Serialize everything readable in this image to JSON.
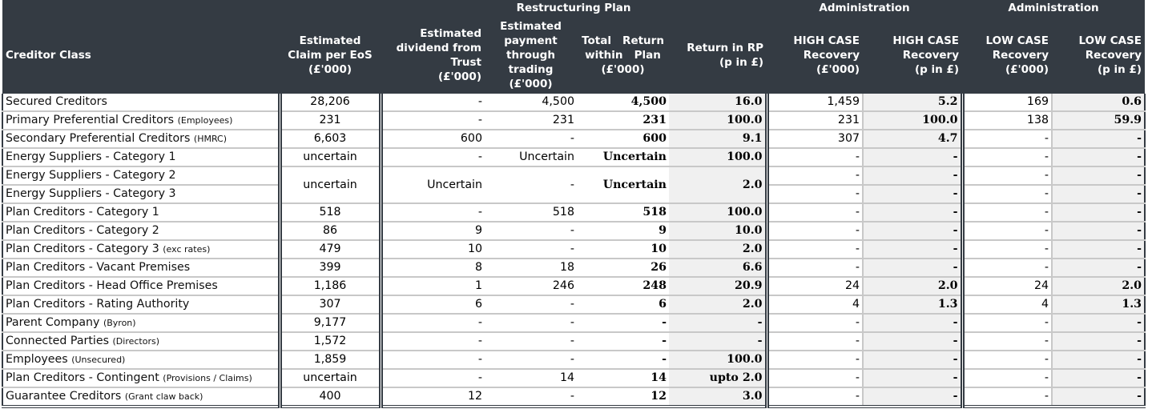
{
  "header": {
    "group_restructuring": "Restructuring Plan",
    "group_admin_high": "Administration",
    "group_admin_low": "Administration",
    "columns": [
      {
        "key": "creditor_class",
        "label": "Creditor Class"
      },
      {
        "key": "claim",
        "label": "Estimated Claim per EoS (£'000)"
      },
      {
        "key": "dividend_trust",
        "label": "Estimated dividend from Trust (£'000)"
      },
      {
        "key": "payment_trading",
        "label": "Estimated payment through trading (£'000)"
      },
      {
        "key": "total_return",
        "label": "Total Return within Plan (£'000)"
      },
      {
        "key": "return_rp",
        "label": "Return in RP (p in £)"
      },
      {
        "key": "high_recovery_k",
        "label": "HIGH CASE Recovery (£'000)"
      },
      {
        "key": "high_recovery_p",
        "label": "HIGH CASE Recovery (p in £)"
      },
      {
        "key": "low_recovery_k",
        "label": "LOW CASE Recovery (£'000)"
      },
      {
        "key": "low_recovery_p",
        "label": "LOW CASE Recovery (p in £)"
      }
    ],
    "col_lines": {
      "claim": [
        "Estimated",
        "Claim per EoS",
        "(£'000)"
      ],
      "dividend_trust": [
        "Estimated",
        "dividend from",
        "Trust",
        "(£'000)"
      ],
      "payment_trading": [
        "Estimated",
        "payment",
        "through",
        "trading",
        "(£'000)"
      ],
      "total_return": [
        "Total   Return",
        "within   Plan",
        "(£'000)"
      ],
      "return_rp": [
        "Return in RP",
        "(p in £)"
      ],
      "high_recovery_k": [
        "HIGH CASE",
        "Recovery",
        "(£'000)"
      ],
      "high_recovery_p": [
        "HIGH CASE",
        "Recovery",
        "(p in £)"
      ],
      "low_recovery_k": [
        "LOW CASE",
        "Recovery",
        "(£'000)"
      ],
      "low_recovery_p": [
        "LOW CASE",
        "Recovery",
        "(p in £)"
      ]
    }
  },
  "rows": [
    {
      "name": "Secured Creditors",
      "note": "",
      "claim": "28,206",
      "dividend_trust": "-",
      "payment_trading": "4,500",
      "total_return": "4,500",
      "return_rp": "16.0",
      "high_k": "1,459",
      "high_p": "5.2",
      "low_k": "169",
      "low_p": "0.6"
    },
    {
      "name": "Primary Preferential Creditors",
      "note": "(Employees)",
      "claim": "231",
      "dividend_trust": "-",
      "payment_trading": "231",
      "total_return": "231",
      "return_rp": "100.0",
      "high_k": "231",
      "high_p": "100.0",
      "low_k": "138",
      "low_p": "59.9"
    },
    {
      "name": "Secondary Preferential Creditors",
      "note": "(HMRC)",
      "claim": "6,603",
      "dividend_trust": "600",
      "payment_trading": "-",
      "total_return": "600",
      "return_rp": "9.1",
      "high_k": "307",
      "high_p": "4.7",
      "low_k": "-",
      "low_p": "-"
    },
    {
      "name": "Energy Suppliers - Category 1",
      "note": "",
      "claim": "uncertain",
      "dividend_trust": "-",
      "payment_trading": "Uncertain",
      "total_return": "Uncertain",
      "return_rp": "100.0",
      "high_k": "-",
      "high_p": "-",
      "low_k": "-",
      "low_p": "-"
    },
    {
      "name": "Energy Suppliers - Category 2",
      "note": "",
      "high_k": "-",
      "high_p": "-",
      "low_k": "-",
      "low_p": "-"
    },
    {
      "name": "Energy Suppliers - Category 3",
      "note": "",
      "high_k": "-",
      "high_p": "-",
      "low_k": "-",
      "low_p": "-"
    },
    {
      "name": "Plan Creditors - Category 1",
      "note": "",
      "claim": "518",
      "dividend_trust": "-",
      "payment_trading": "518",
      "total_return": "518",
      "return_rp": "100.0",
      "high_k": "-",
      "high_p": "-",
      "low_k": "-",
      "low_p": "-"
    },
    {
      "name": "Plan Creditors - Category 2",
      "note": "",
      "claim": "86",
      "dividend_trust": "9",
      "payment_trading": "-",
      "total_return": "9",
      "return_rp": "10.0",
      "high_k": "-",
      "high_p": "-",
      "low_k": "-",
      "low_p": "-"
    },
    {
      "name": "Plan Creditors - Category 3",
      "note": "(exc rates)",
      "claim": "479",
      "dividend_trust": "10",
      "payment_trading": "-",
      "total_return": "10",
      "return_rp": "2.0",
      "high_k": "-",
      "high_p": "-",
      "low_k": "-",
      "low_p": "-"
    },
    {
      "name": "Plan Creditors - Vacant Premises",
      "note": "",
      "claim": "399",
      "dividend_trust": "8",
      "payment_trading": "18",
      "total_return": "26",
      "return_rp": "6.6",
      "high_k": "-",
      "high_p": "-",
      "low_k": "-",
      "low_p": "-"
    },
    {
      "name": "Plan Creditors - Head Office Premises",
      "note": "",
      "claim": "1,186",
      "dividend_trust": "1",
      "payment_trading": "246",
      "total_return": "248",
      "return_rp": "20.9",
      "high_k": "24",
      "high_p": "2.0",
      "low_k": "24",
      "low_p": "2.0"
    },
    {
      "name": "Plan Creditors - Rating Authority",
      "note": "",
      "claim": "307",
      "dividend_trust": "6",
      "payment_trading": "-",
      "total_return": "6",
      "return_rp": "2.0",
      "high_k": "4",
      "high_p": "1.3",
      "low_k": "4",
      "low_p": "1.3"
    },
    {
      "name": "Parent Company",
      "note": "(Byron)",
      "claim": "9,177",
      "dividend_trust": "-",
      "payment_trading": "-",
      "total_return": "-",
      "return_rp": "-",
      "high_k": "-",
      "high_p": "-",
      "low_k": "-",
      "low_p": "-"
    },
    {
      "name": "Connected Parties",
      "note": "(Directors)",
      "claim": "1,572",
      "dividend_trust": "-",
      "payment_trading": "-",
      "total_return": "-",
      "return_rp": "-",
      "high_k": "-",
      "high_p": "-",
      "low_k": "-",
      "low_p": "-"
    },
    {
      "name": "Employees",
      "note": "(Unsecured)",
      "claim": "1,859",
      "dividend_trust": "-",
      "payment_trading": "-",
      "total_return": "-",
      "return_rp": "100.0",
      "high_k": "-",
      "high_p": "-",
      "low_k": "-",
      "low_p": "-"
    },
    {
      "name": "Plan Creditors - Contingent",
      "note": "(Provisions / Claims)",
      "claim": "uncertain",
      "dividend_trust": "-",
      "payment_trading": "14",
      "total_return": "14",
      "return_rp": "upto 2.0",
      "high_k": "-",
      "high_p": "-",
      "low_k": "-",
      "low_p": "-"
    },
    {
      "name": "Guarantee Creditors",
      "note": "(Grant claw back)",
      "claim": "400",
      "dividend_trust": "12",
      "payment_trading": "-",
      "total_return": "12",
      "return_rp": "3.0",
      "high_k": "-",
      "high_p": "-",
      "low_k": "-",
      "low_p": "-"
    }
  ],
  "merged_energy_2_3": {
    "claim": "uncertain",
    "dividend_trust": "Uncertain",
    "payment_trading": "-",
    "total_return": "Uncertain",
    "return_rp": "2.0"
  },
  "colors": {
    "header_bg": "#343b43",
    "header_text": "#ffffff",
    "shaded_cell": "#f0f0f0",
    "grid_line": "#c8c8c8"
  }
}
